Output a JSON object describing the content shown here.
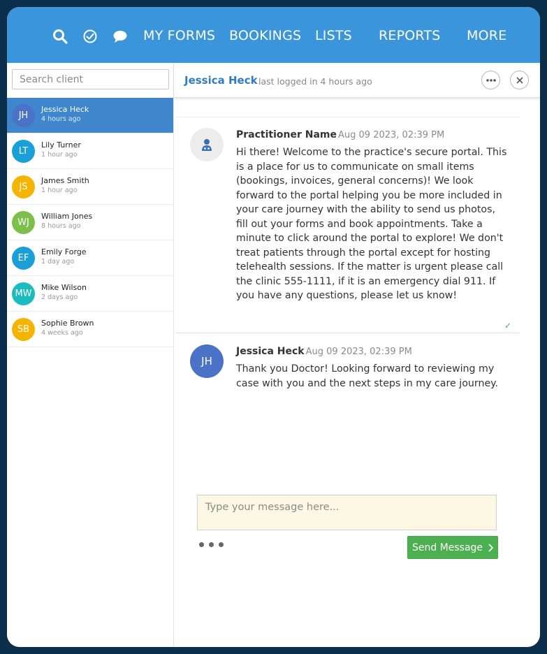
{
  "nav": {
    "icons": [
      "search-icon",
      "check-circle-icon",
      "chat-bubble-icon"
    ],
    "links": [
      "MY FORMS",
      "BOOKINGS",
      "LISTS",
      "REPORTS",
      "MORE"
    ]
  },
  "sidebar": {
    "search_placeholder": "Search client",
    "clients": [
      {
        "initials": "JH",
        "name": "Jessica Heck",
        "time": "4 hours ago",
        "color": "#4a72c6",
        "active": true
      },
      {
        "initials": "LT",
        "name": "Lily Turner",
        "time": "1 hour ago",
        "color": "#1a9fd8"
      },
      {
        "initials": "JS",
        "name": "James Smith",
        "time": "1 hour ago",
        "color": "#f5b400"
      },
      {
        "initials": "WJ",
        "name": "William Jones",
        "time": "8 hours ago",
        "color": "#7cc04b"
      },
      {
        "initials": "EF",
        "name": "Emily Forge",
        "time": "1 day ago",
        "color": "#1a9fd8"
      },
      {
        "initials": "MW",
        "name": "Mike Wilson",
        "time": "2 days ago",
        "color": "#1bbbc0"
      },
      {
        "initials": "SB",
        "name": "Sophie Brown",
        "time": "4 weeks ago",
        "color": "#f5b400"
      }
    ]
  },
  "chat": {
    "client_name": "Jessica Heck",
    "status": "last logged in 4 hours ago",
    "more_icon": "more-horizontal-icon",
    "close_icon": "close-icon",
    "messages": [
      {
        "author": "Practitioner Name",
        "timestamp": "Aug 09 2023, 02:39 PM",
        "avatar_icon": "practitioner-icon",
        "text": "Hi there! Welcome to the practice's secure portal. This is a place for us to communicate on small items (bookings, invoices, general concerns)! We look forward to the portal helping you be more included in your care journey with the ability to send us photos, fill out your forms and book appointments. Take a minute to click around the portal to explore! We don't treat patients through the portal except for hosting telehealth sessions. If the matter is urgent please call the clinic 555-1111, if it is an emergency dial 911. If you have any questions, please let us know!",
        "read_icon": "checkmark-icon"
      },
      {
        "author": "Jessica Heck",
        "timestamp": "Aug 09 2023, 02:39 PM",
        "avatar_initials": "JH",
        "avatar_color": "#4a72c6",
        "text": "Thank you Doctor! Looking forward to reviewing my case with you and the next steps in my care journey."
      }
    ],
    "composer_placeholder": "Type your message here...",
    "send_label": "Send Message"
  },
  "colors": {
    "nav_bg": "#3b95da",
    "active_row": "#3f86cc",
    "send_button": "#4cb050",
    "composer_bg": "#fdf8e3",
    "frame_border": "#0b2e4a"
  }
}
